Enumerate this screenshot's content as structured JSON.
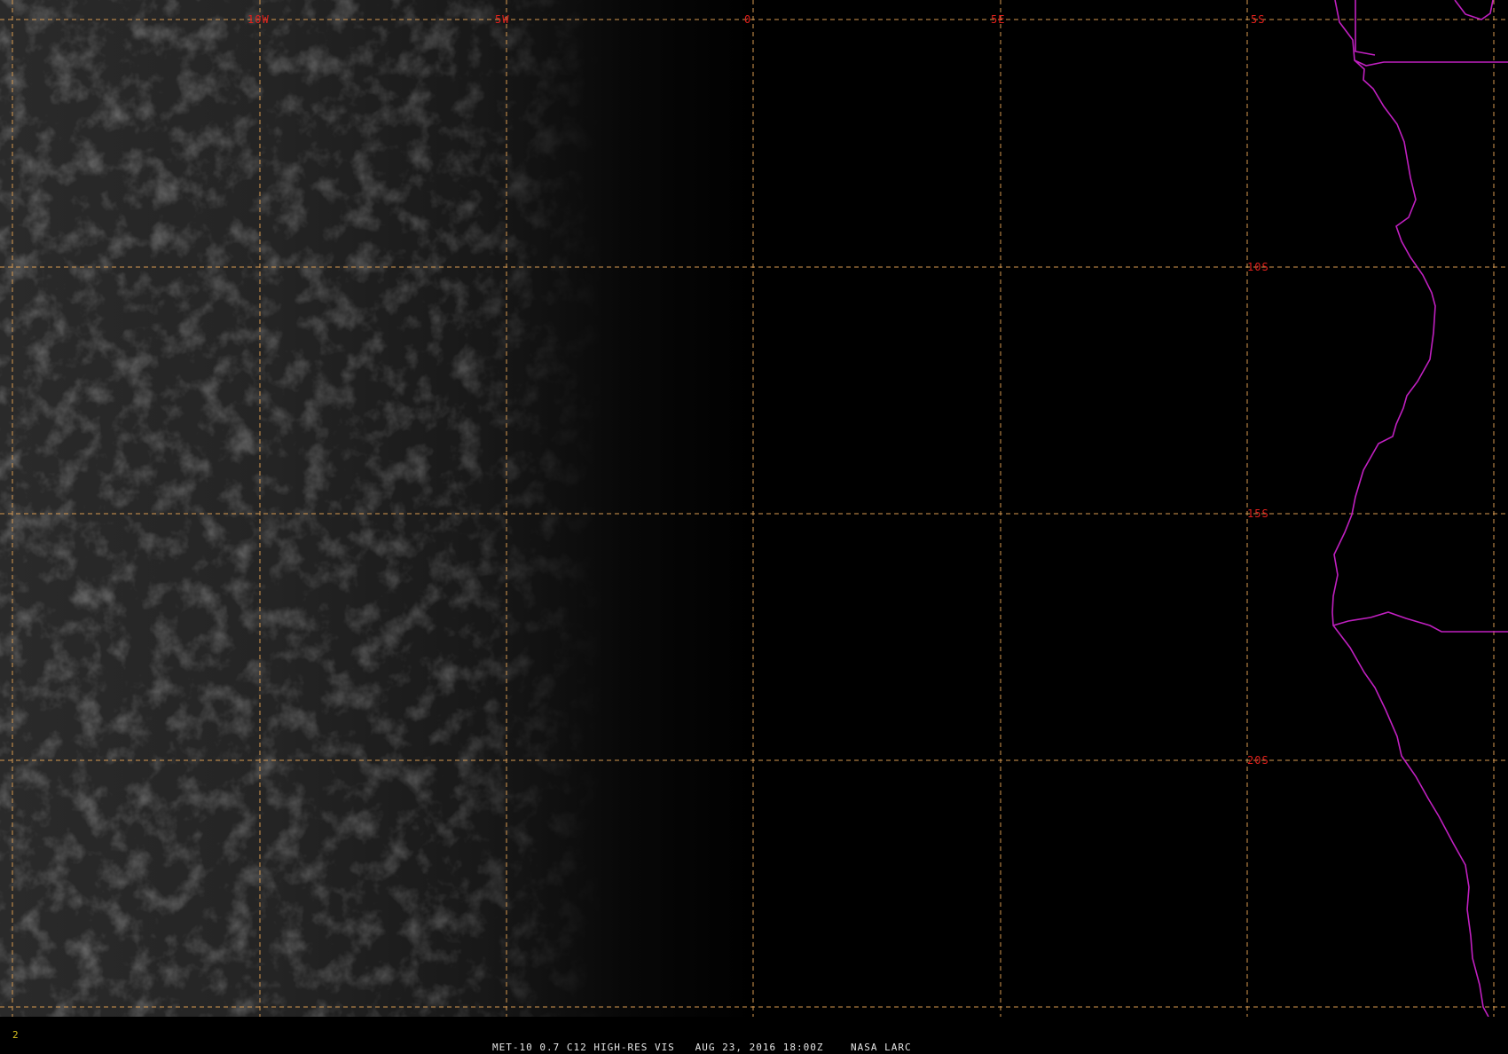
{
  "colors": {
    "grid": "#d89a50",
    "grid_labels": "#e0201c",
    "coastline": "#c020c0",
    "caption_text": "#e6e6e6",
    "frame_number": "#d8c020"
  },
  "grid": {
    "longitude_labels": [
      "10W",
      "5W",
      "0",
      "5E"
    ],
    "latitude_labels": [
      "5S",
      "10S",
      "15S",
      "20S"
    ]
  },
  "caption": {
    "frame_number": "2",
    "title": "MET-10 0.7 C12 HIGH-RES VIS   AUG 23, 2016 18:00Z    NASA LARC"
  }
}
